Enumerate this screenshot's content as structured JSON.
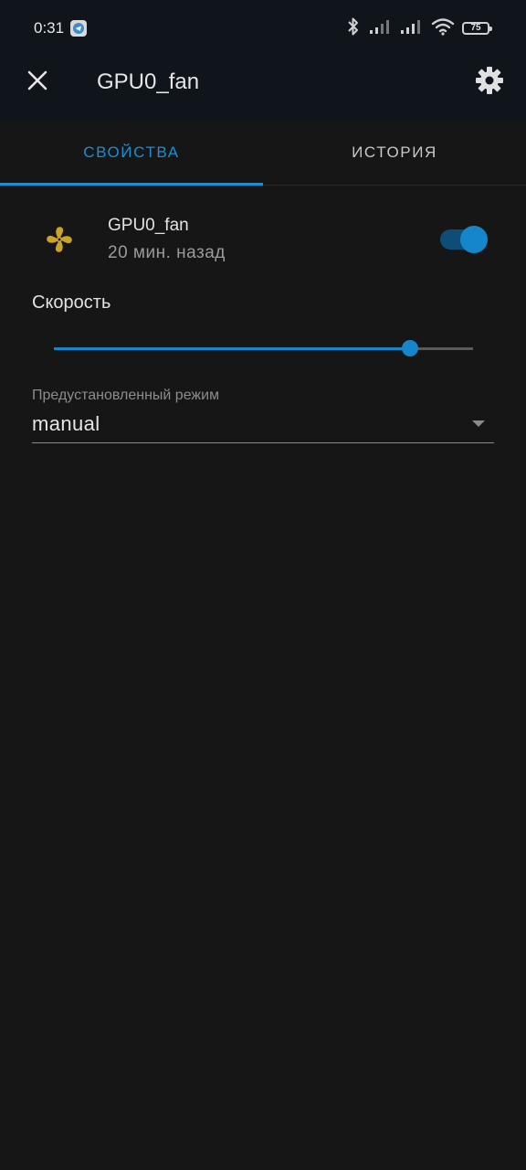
{
  "status_bar": {
    "time": "0:31",
    "battery": "75"
  },
  "app_bar": {
    "title": "GPU0_fan"
  },
  "tabs": [
    {
      "label": "СВОЙСТВА",
      "active": true
    },
    {
      "label": "ИСТОРИЯ",
      "active": false
    }
  ],
  "entity": {
    "name": "GPU0_fan",
    "last_changed": "20 мин. назад",
    "icon": "fan-icon",
    "icon_color": "#c9a32c",
    "state_on": true
  },
  "speed": {
    "label": "Скорость",
    "value_fraction": 0.85
  },
  "preset": {
    "label": "Предустановленный режим",
    "value": "manual"
  },
  "colors": {
    "accent": "#1586cc",
    "background": "#161616",
    "header": "#0f151b"
  }
}
